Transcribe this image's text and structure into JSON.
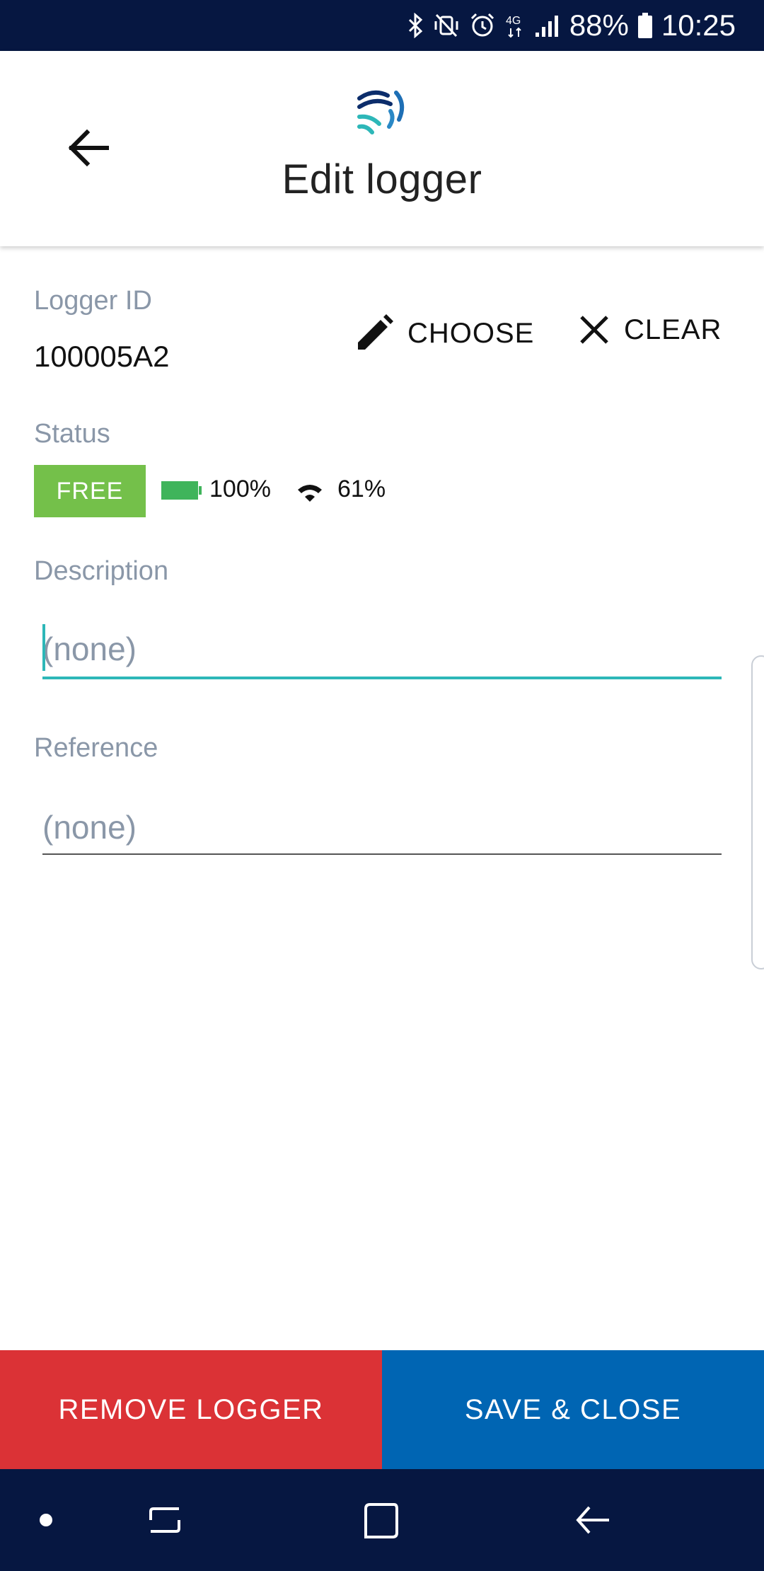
{
  "status_bar": {
    "battery_percent": "88%",
    "time": "10:25",
    "network": "4G",
    "icons": [
      "bluetooth-icon",
      "vibrate-mute-icon",
      "alarm-icon",
      "network-4g-icon",
      "signal-icon",
      "battery-icon"
    ]
  },
  "header": {
    "title": "Edit logger",
    "back_icon": "arrow-left-icon",
    "logo_icon": "app-logo-icon"
  },
  "logger": {
    "id_label": "Logger ID",
    "id_value": "100005A2",
    "choose_label": "CHOOSE",
    "clear_label": "CLEAR"
  },
  "status": {
    "label": "Status",
    "badge": "FREE",
    "battery": "100%",
    "signal": "61%"
  },
  "description": {
    "label": "Description",
    "placeholder": "(none)",
    "value": ""
  },
  "reference": {
    "label": "Reference",
    "placeholder": "(none)",
    "value": ""
  },
  "actions": {
    "remove_label": "REMOVE LOGGER",
    "save_label": "SAVE & CLOSE"
  },
  "colors": {
    "status_bar": "#061741",
    "accent_teal": "#2db7b8",
    "badge_green": "#74c04a",
    "battery_green": "#3fb45b",
    "remove_red": "#db3236",
    "save_blue": "#0065b3"
  }
}
